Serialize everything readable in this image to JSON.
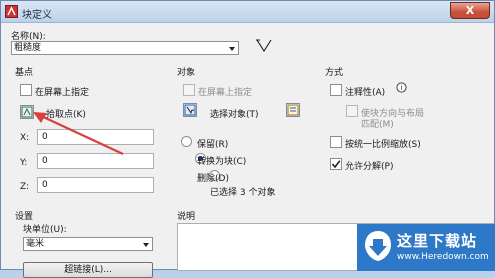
{
  "window": {
    "title": "块定义",
    "close_glyph": "X"
  },
  "name": {
    "label": "名称(N):",
    "value": "粗糙度"
  },
  "base_point": {
    "title": "基点",
    "specify_on_screen": "在屏幕上指定",
    "pick_point": "拾取点(K)",
    "x_label": "X:",
    "x_value": "0",
    "y_label": "Y:",
    "y_value": "0",
    "z_label": "Z:",
    "z_value": "0"
  },
  "objects": {
    "title": "对象",
    "specify_on_screen": "在屏幕上指定",
    "select_objects": "选择对象(T)",
    "retain": "保留(R)",
    "convert_to_block": "转换为块(C)",
    "delete": "删除(D)",
    "status": "已选择 3 个对象"
  },
  "behavior": {
    "title": "方式",
    "annotative": "注释性(A)",
    "match_orientation_line1": "使块方向与布局",
    "match_orientation_line2": "匹配(M)",
    "scale_uniformly": "按统一比例缩放(S)",
    "allow_exploding": "允许分解(P)"
  },
  "settings": {
    "title": "设置",
    "block_unit_label": "块单位(U):",
    "block_unit_value": "毫米",
    "hyperlink_button": "超链接(L)..."
  },
  "description": {
    "title": "说明"
  },
  "watermark": {
    "name": "这里下载站",
    "url": "www.Heredown.com"
  },
  "colors": {
    "arrow": "#d9403a",
    "selected_radio": "#1f3f8a",
    "watermark_bg": "#2d79c7"
  }
}
